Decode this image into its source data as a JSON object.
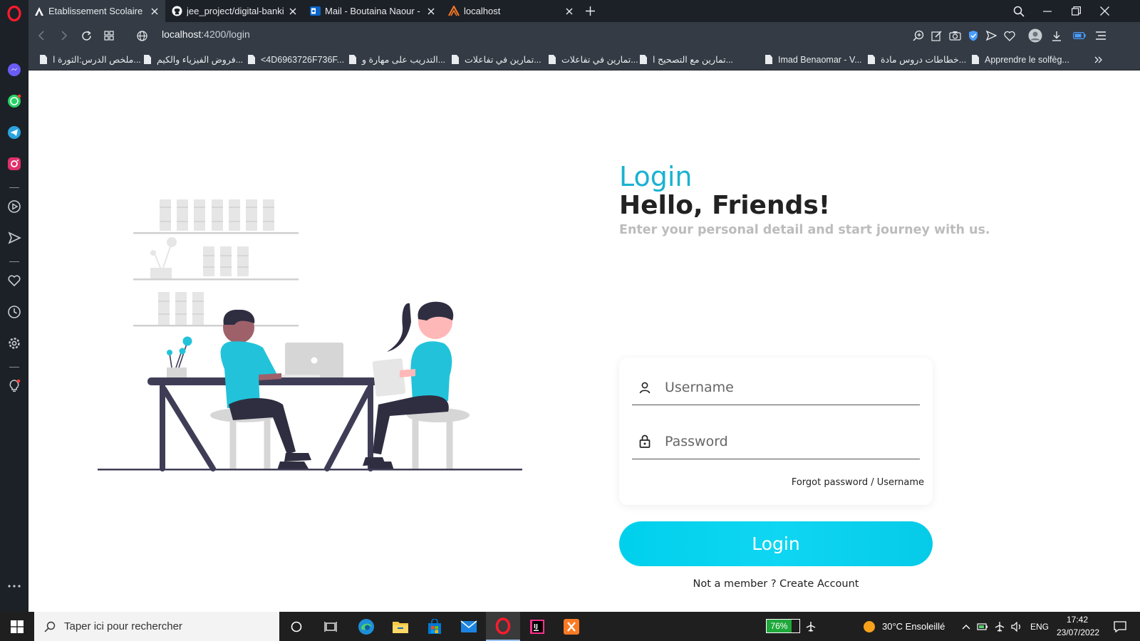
{
  "browser": {
    "tabs": [
      {
        "title": "Etablissement Scolaire",
        "icon": "a-logo-icon",
        "active": true
      },
      {
        "title": "jee_project/digital-banking",
        "icon": "github-icon",
        "active": false
      },
      {
        "title": "Mail - Boutaina Naour - Ou",
        "icon": "outlook-icon",
        "active": false
      },
      {
        "title": "localhost",
        "icon": "xampp-icon",
        "active": false
      }
    ],
    "url_host": "localhost",
    "url_path": ":4200/login",
    "bookmarks": [
      "ملخص الدرس:الثورة ا...",
      "فروض الفيزياء والكيم...",
      "<4D6963726F736F...",
      "التدريب على مهارة و...",
      "تمارين في تفاعلات...",
      "تمارين في تفاعلات...",
      "تمارين مع التصحيح ا...",
      "Imad Benaomar - V...",
      "خطاطات دروس مادة...",
      "Apprendre le solfèg..."
    ]
  },
  "login": {
    "heading": "Login",
    "greeting": "Hello, Friends!",
    "subtitle": "Enter your personal detail and start journey with us.",
    "username_placeholder": "Username",
    "password_placeholder": "Password",
    "forgot_link": "Forgot password / Username",
    "submit_label": "Login",
    "create_account": "Not a member ? Create Account",
    "accent_color": "#1ab2d1",
    "button_color": "#00d0ec"
  },
  "taskbar": {
    "search_placeholder": "Taper ici pour rechercher",
    "battery_percent": "76%",
    "battery_level": 0.76,
    "weather": "30°C  Ensoleillé",
    "language": "ENG",
    "time": "17:42",
    "date": "23/07/2022"
  }
}
